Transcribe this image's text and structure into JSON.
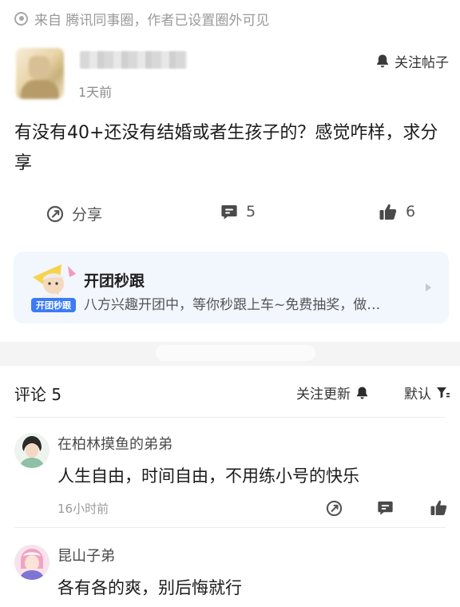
{
  "source": {
    "text": "来自 腾讯同事圈，作者已设置圈外可见",
    "icon": "circle-dot-icon"
  },
  "post": {
    "time": "1天前",
    "follow_label": "关注帖子",
    "content": "有没有40+还没有结婚或者生孩子的？感觉咋样，求分享",
    "actions": {
      "share_label": "分享",
      "comment_count": "5",
      "like_count": "6"
    }
  },
  "promo": {
    "title": "开团秒跟",
    "desc": "八方兴趣开团中，等你秒跟上车~免费抽奖，做…",
    "badge": "开团秒跟"
  },
  "comments_section": {
    "title": "评论 5",
    "follow_update_label": "关注更新",
    "sort_label": "默认",
    "items": [
      {
        "name": "在柏林摸鱼的弟弟",
        "text": "人生自由，时间自由，不用练小号的快乐",
        "time": "16小时前"
      },
      {
        "name": "昆山子弟",
        "text": "各有各的爽，别后悔就行"
      }
    ]
  },
  "colors": {
    "accent_blue": "#3b7bf6",
    "promo_bg": "#f2f6fd",
    "icon_gray": "#5a5a5a"
  }
}
